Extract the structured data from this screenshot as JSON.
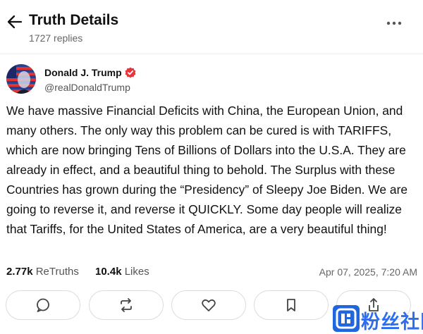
{
  "header": {
    "title": "Truth Details",
    "replies": "1727 replies"
  },
  "author": {
    "name": "Donald J. Trump",
    "handle": "@realDonaldTrump"
  },
  "post": {
    "text": "We have massive Financial Deficits with China, the European Union, and many others. The only way this problem can be cured is with TARIFFS, which are now bringing Tens of Billions of Dollars into the U.S.A. They are already in effect, and a beautiful thing to behold. The Surplus with these Countries has grown during the “Presidency” of Sleepy Joe Biden. We are going to reverse it, and reverse it QUICKLY. Some day people will realize that Tariffs, for the United States of America, are a very beautiful thing!"
  },
  "stats": {
    "retruths_count": "2.77k",
    "retruths_label": "ReTruths",
    "likes_count": "10.4k",
    "likes_label": "Likes",
    "timestamp": "Apr 07, 2025, 7:20 AM"
  },
  "actions": [
    "reply-icon",
    "retruth-icon",
    "like-icon",
    "bookmark-icon",
    "share-icon"
  ],
  "watermark": {
    "text": "粉丝社区"
  },
  "colors": {
    "verified": "#e8343c",
    "watermark": "#1f66e0"
  }
}
